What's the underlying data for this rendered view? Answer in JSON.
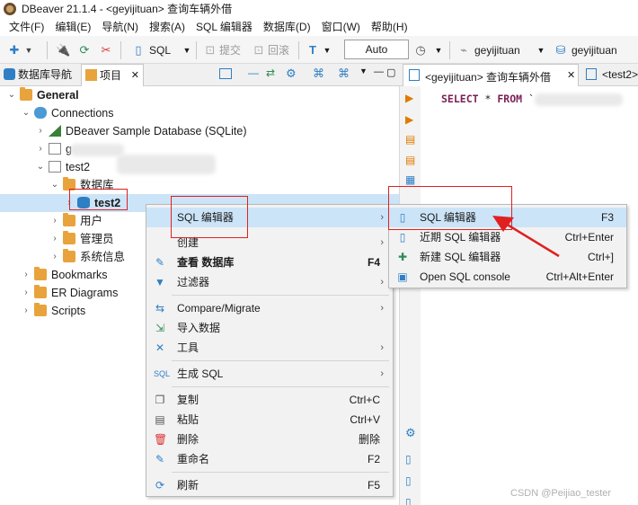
{
  "window": {
    "title": "DBeaver 21.1.4 - <geyijituan> 查询车辆外借"
  },
  "menubar": [
    "文件(F)",
    "编辑(E)",
    "导航(N)",
    "搜索(A)",
    "SQL 编辑器",
    "数据库(D)",
    "窗口(W)",
    "帮助(H)"
  ],
  "toolbar": {
    "sql_label": "SQL",
    "commit_label": "提交",
    "rollback_label": "回滚",
    "auto_label": "Auto",
    "connection_label": "geyijituan",
    "schema_label": "geyijituan"
  },
  "left_tabs": {
    "nav_label": "数据库导航",
    "project_label": "项目"
  },
  "tree": {
    "general": "General",
    "connections": "Connections",
    "sample_db": "DBeaver Sample Database (SQLite)",
    "conn_blurred": "g",
    "test2_conn": "test2",
    "databases_folder": "数据库",
    "test2_db": "test2",
    "users": "用户",
    "admins": "管理员",
    "sysinfo": "系统信息",
    "bookmarks": "Bookmarks",
    "er": "ER Diagrams",
    "scripts": "Scripts"
  },
  "editor_tabs": {
    "tab1": "<geyijituan> 查询车辆外借",
    "tab2": "<test2>"
  },
  "editor": {
    "kw_select": "SELECT",
    "star": "*",
    "kw_from": "FROM",
    "tick": "`"
  },
  "context_menu": {
    "items": [
      {
        "label": "SQL 编辑器",
        "shortcut": "",
        "submenu": true
      },
      {
        "label": "创建",
        "shortcut": "",
        "submenu": true
      },
      {
        "label": "查看 数据库",
        "shortcut": "F4",
        "submenu": false
      },
      {
        "label": "过滤器",
        "shortcut": "",
        "submenu": true
      },
      {
        "label": "Compare/Migrate",
        "shortcut": "",
        "submenu": true
      },
      {
        "label": "导入数据",
        "shortcut": "",
        "submenu": false
      },
      {
        "label": "工具",
        "shortcut": "",
        "submenu": true
      },
      {
        "label": "生成 SQL",
        "shortcut": "",
        "submenu": true
      },
      {
        "label": "复制",
        "shortcut": "Ctrl+C",
        "submenu": false
      },
      {
        "label": "粘贴",
        "shortcut": "Ctrl+V",
        "submenu": false
      },
      {
        "label": "删除",
        "shortcut": "删除",
        "submenu": false
      },
      {
        "label": "重命名",
        "shortcut": "F2",
        "submenu": false
      },
      {
        "label": "刷新",
        "shortcut": "F5",
        "submenu": false
      }
    ]
  },
  "submenu": {
    "items": [
      {
        "label": "SQL 编辑器",
        "shortcut": "F3"
      },
      {
        "label": "近期 SQL 编辑器",
        "shortcut": "Ctrl+Enter"
      },
      {
        "label": "新建 SQL 编辑器",
        "shortcut": "Ctrl+]"
      },
      {
        "label": "Open SQL console",
        "shortcut": "Ctrl+Alt+Enter"
      }
    ]
  },
  "watermark": "CSDN @Peijiao_tester",
  "colors": {
    "accent_red": "#e02020",
    "highlight": "#cce4f7",
    "keyword": "#7b1f55"
  }
}
